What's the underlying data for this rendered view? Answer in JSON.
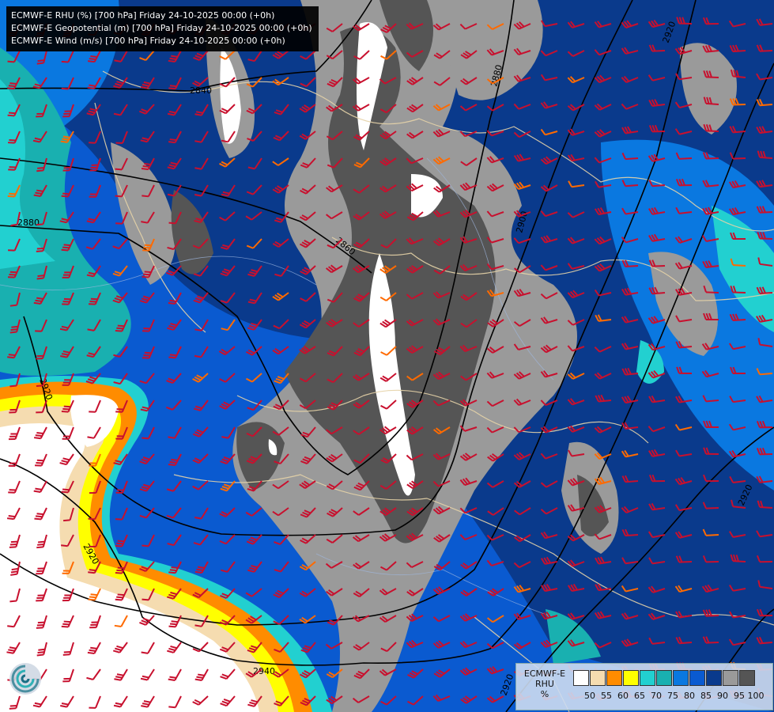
{
  "header": {
    "lines": [
      "ECMWF-E RHU (%) [700 hPa] Friday 24-10-2025 00:00 (+0h)",
      "ECMWF-E Geopotential (m) [700 hPa] Friday 24-10-2025 00:00 (+0h)",
      "ECMWF-E Wind (m/s) [700 hPa] Friday 24-10-2025 00:00 (+0h)"
    ]
  },
  "contours": {
    "labels": [
      "2840",
      "2860",
      "2880",
      "2880",
      "2900",
      "2920",
      "2920",
      "2920",
      "2920",
      "2940",
      "2920"
    ]
  },
  "legend": {
    "model": "ECMWF-E",
    "variable": "RHU",
    "unit": "%",
    "colors": [
      "#ffffff",
      "#f5dcb0",
      "#ff8c00",
      "#ffff00",
      "#22d0d0",
      "#19b0b0",
      "#0a78e0",
      "#0a5ad0",
      "#0a3a8c",
      "#9a9a9a",
      "#555555"
    ],
    "ticks": [
      "50",
      "55",
      "60",
      "65",
      "70",
      "75",
      "80",
      "85",
      "90",
      "95",
      "100"
    ]
  },
  "logo": "ecmwf-logo-icon"
}
